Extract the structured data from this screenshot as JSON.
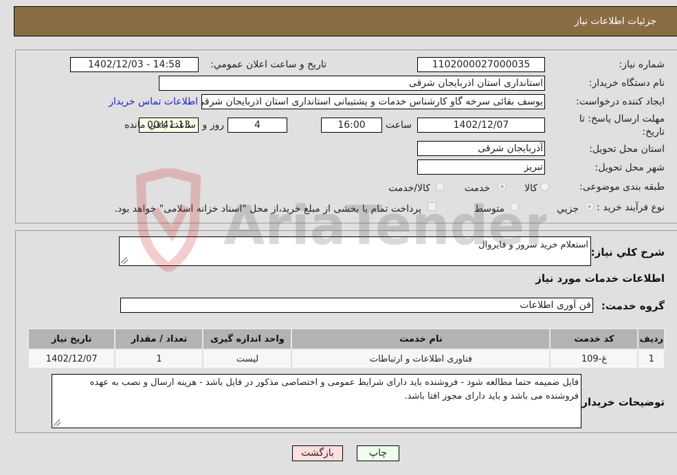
{
  "header": {
    "title": "جزئيات اطلاعات نياز"
  },
  "form": {
    "need_number_label": "شماره نياز:",
    "need_number": "1102000027000035",
    "announce_label": "تاريخ و ساعت اعلان عمومي:",
    "announce_value": "1402/12/03 - 14:58",
    "buyer_org_label": "نام دستگاه خريدار:",
    "buyer_org": "استانداری استان اذربایجان شرقی",
    "creator_label": "ايجاد کننده درخواست:",
    "creator": "یوسف بقائی سرخه گاو کارشناس خدمات و پشتیبانی استانداری استان اذربایجان شرقی",
    "contact_link": "اطلاعات تماس خريدار",
    "deadline_label": "مهلت ارسال پاسخ: تا تاريخ:",
    "deadline_date": "1402/12/07",
    "time_label": "ساعت",
    "deadline_time": "16:00",
    "days_value": "4",
    "days_label": "روز و",
    "remaining_time": "00:41:13",
    "remaining_label": "ساعت باقي مانده",
    "province_label": "استان محل تحويل:",
    "province": "آذربایجان شرقی",
    "city_label": "شهر محل تحويل:",
    "city": "تبریز",
    "category_label": "طبقه بندی موضوعی:",
    "category_options": [
      "کالا",
      "خدمت",
      "کالا/خدمت"
    ],
    "category_selected": "خدمت",
    "process_label": "نوع فرآيند خريد :",
    "process_options": [
      "جزيي",
      "متوسط"
    ],
    "process_selected": "جزيي",
    "treasury_note": "پرداخت تمام يا بخشی از مبلغ خريد،از محل \"اسناد خزانه اسلامی\" خواهد بود."
  },
  "details": {
    "summary_label": "شرح کلي نياز:",
    "summary": "استعلام خرید سرور و فایروال",
    "services_heading": "اطلاعات خدمات مورد نياز",
    "service_group_label": "گروه خدمت:",
    "service_group": "فن آوری اطلاعات",
    "table": {
      "headers": [
        "رديف",
        "کد خدمت",
        "نام خدمت",
        "واحد اندازه گيری",
        "تعداد / مقدار",
        "تاريخ نياز"
      ],
      "rows": [
        [
          "1",
          "غ-109",
          "فناوری اطلاعات و ارتباطات",
          "لیست",
          "1",
          "1402/12/07"
        ]
      ]
    },
    "buyer_notes_label": "توضيحات خريدار:",
    "buyer_notes": "فایل ضمیمه حتما مطالعه شود - فروشنده باید دارای شرایط عمومی و اختصاصی مذکور در فایل باشد - هزینه ارسال و نصب به عهده فروشنده می باشد و باید دارای مجوز افتا باشد."
  },
  "buttons": {
    "print": "چاپ",
    "back": "بازگشت"
  },
  "watermark": {
    "text": "AriaTender.neT"
  }
}
